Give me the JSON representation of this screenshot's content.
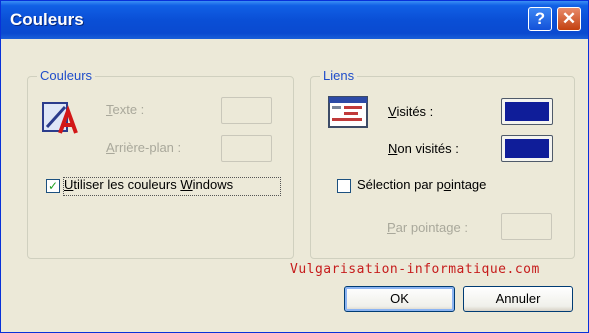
{
  "window": {
    "title": "Couleurs",
    "help_glyph": "?",
    "close_glyph": "✕"
  },
  "colors_group": {
    "legend": "Couleurs",
    "icon": "text-palette-icon",
    "text_label_u": "T",
    "text_label_rest": "exte :",
    "background_label_u": "A",
    "background_label_rest": "rrière-plan :",
    "windows_colors_u": "U",
    "windows_colors_mid": "tiliser les couleurs ",
    "windows_colors_u2": "W",
    "windows_colors_end": "indows",
    "windows_colors_checked": true
  },
  "links_group": {
    "legend": "Liens",
    "icon": "webpage-links-icon",
    "visited_u": "V",
    "visited_rest": "isités :",
    "visited_color": "#0f1d99",
    "unvisited_u": "N",
    "unvisited_rest": "on visités :",
    "unvisited_color": "#0f1d99",
    "hover_pre": "Sélection par p",
    "hover_u": "o",
    "hover_rest": "intage",
    "hover_checked": false,
    "hover_label_u": "P",
    "hover_label_rest": "ar pointage :"
  },
  "watermark": "Vulgarisation-informatique.com",
  "buttons": {
    "ok": "OK",
    "cancel": "Annuler"
  },
  "accent_colors": {
    "titlebar": "#0a4fd6",
    "legend": "#1f4dca",
    "link": "#0f1d99",
    "close": "#c3400f"
  }
}
